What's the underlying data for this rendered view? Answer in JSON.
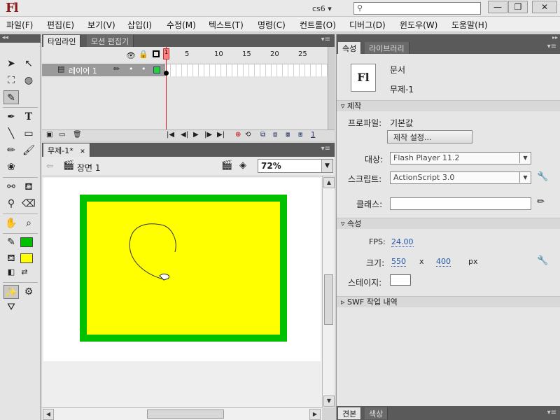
{
  "titlebar": {
    "logo": "Fl",
    "workspace": "cs6 ▾",
    "search_placeholder": ""
  },
  "window_buttons": {
    "minimize": "—",
    "restore": "❐",
    "close": "✕"
  },
  "menu": [
    "파일(F)",
    "편집(E)",
    "보기(V)",
    "삽입(I)",
    "수정(M)",
    "텍스트(T)",
    "명령(C)",
    "컨트롤(O)",
    "디버그(D)",
    "윈도우(W)",
    "도움말(H)"
  ],
  "timeline": {
    "tabs": [
      "타임라인",
      "모션 편집기"
    ],
    "layer_name": "레이어 1",
    "frame_numbers": [
      "1",
      "5",
      "10",
      "15",
      "20",
      "25"
    ],
    "current_frame": "1"
  },
  "document": {
    "tab": "무제-1*",
    "scene": "장면 1",
    "zoom": "72%",
    "stage_color": "#ffff00",
    "border_color": "#00c000"
  },
  "properties": {
    "tabs": [
      "속성",
      "라이브러리"
    ],
    "doc_type": "문서",
    "doc_name": "무제-1",
    "icon_letter": "Fl",
    "publish_section": "제작",
    "profile_label": "프로파일:",
    "profile_value": "기본값",
    "publish_settings_button": "제작 설정...",
    "target_label": "대상:",
    "target_value": "Flash Player 11.2",
    "script_label": "스크립트:",
    "script_value": "ActionScript 3.0",
    "class_label": "클래스:",
    "class_value": "",
    "props_section": "속성",
    "fps_label": "FPS:",
    "fps_value": "24.00",
    "size_label": "크기:",
    "width": "550",
    "x": "x",
    "height": "400",
    "unit": "px",
    "stage_label": "스테이지:",
    "stage_color": "#ffffff",
    "swf_section": "SWF 작업 내역",
    "bottom_tabs": [
      "견본",
      "색상"
    ]
  },
  "toolbar": {
    "stroke_color": "#00c000",
    "fill_color": "#ffff00"
  }
}
